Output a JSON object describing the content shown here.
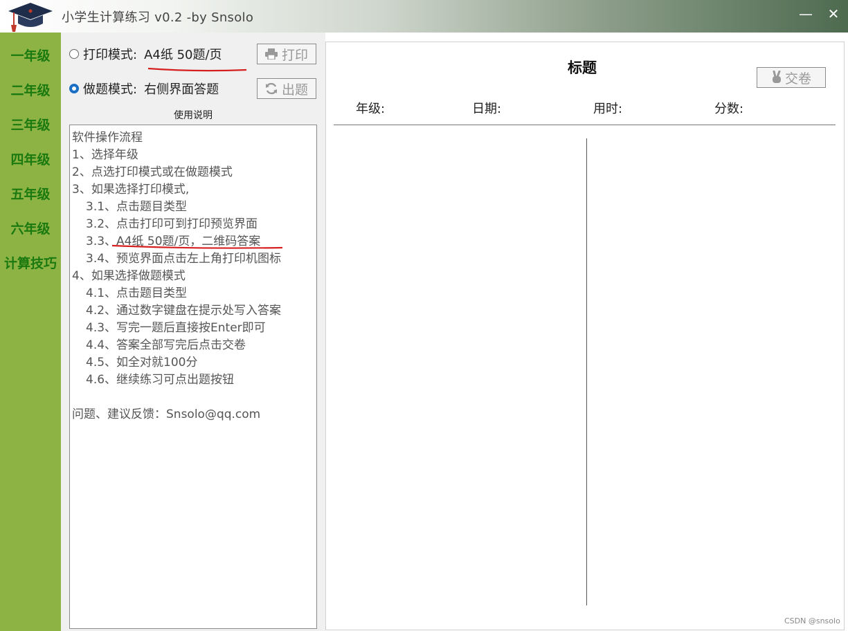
{
  "window": {
    "title": "小学生计算练习 v0.2  -by Snsolo",
    "minimize_glyph": "—",
    "close_glyph": "✕"
  },
  "sidebar": {
    "items": [
      {
        "label": "一年级"
      },
      {
        "label": "二年级"
      },
      {
        "label": "三年级"
      },
      {
        "label": "四年级"
      },
      {
        "label": "五年级"
      },
      {
        "label": "六年级"
      },
      {
        "label": "计算技巧"
      }
    ]
  },
  "modes": {
    "print": {
      "label": "打印模式:",
      "desc": "A4纸  50题/页",
      "selected": false
    },
    "practice": {
      "label": "做题模式:",
      "desc": "右侧界面答题",
      "selected": true
    }
  },
  "buttons": {
    "print_label": "打印",
    "generate_label": "出题",
    "submit_label": "交卷"
  },
  "help": {
    "title": "使用说明",
    "lines": [
      "软件操作流程",
      "1、选择年级",
      "2、点选打印模式或在做题模式",
      "3、如果选择打印模式,",
      "3.1、点击题目类型",
      "3.2、点击打印可到打印预览界面",
      "3.3、A4纸 50题/页，二维码答案",
      "3.4、预览界面点击左上角打印机图标",
      "4、如果选择做题模式",
      "4.1、点击题目类型",
      "4.2、通过数字键盘在提示处写入答案",
      "4.3、写完一题后直接按Enter即可",
      "4.4、答案全部写完后点击交卷",
      "4.5、如全对就100分",
      "4.6、继续练习可点出题按钮",
      "",
      "问题、建议反馈：Snsolo@qq.com"
    ]
  },
  "sheet": {
    "title": "标题",
    "grade_label": "年级:",
    "date_label": "日期:",
    "time_label": "用时:",
    "score_label": "分数:"
  },
  "watermark": "CSDN @snsolo",
  "colors": {
    "sidebar_bg": "#8db345",
    "sidebar_text": "#1b7a0f",
    "annotation_red": "#d62020",
    "radio_selected": "#1a6fc4"
  }
}
